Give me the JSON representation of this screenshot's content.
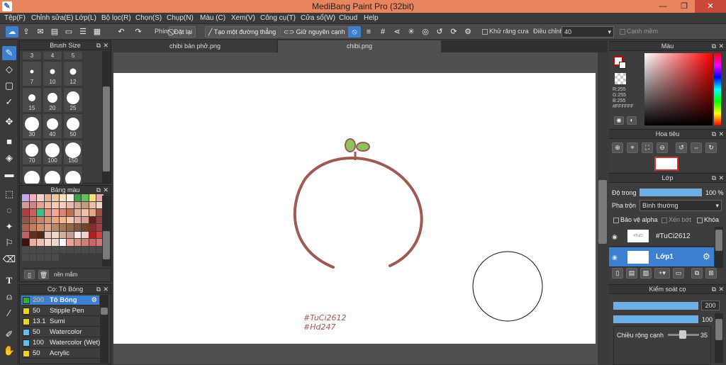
{
  "title": "MediBang Paint Pro (32bit)",
  "menu": [
    "Tệp(F)",
    "Chỉnh sửa(E)",
    "Lớp(L)",
    "Bộ lọc(R)",
    "Chọn(S)",
    "Chụp(N)",
    "Màu (C)",
    "Xem(V)",
    "Công cụ(T)",
    "Cửa sổ(W)",
    "Cloud",
    "Help"
  ],
  "toolbar": {
    "key_label": "Phím",
    "reset": "Đặt lại",
    "straight": "Tạo một đường thẳng",
    "keep_edge": "Giữ nguyên cạnh",
    "antialias": "Khử răng cưa",
    "adjust_label": "Điều chỉnh",
    "adjust_value": "40",
    "canh_mem": "Cạnh mềm"
  },
  "tabs": [
    "chibi bản phở.png",
    "chibi.png"
  ],
  "brush_size": {
    "title": "Brush Size",
    "sizes": [
      "3",
      "4",
      "5",
      "7",
      "10",
      "12",
      "15",
      "20",
      "25",
      "30",
      "40",
      "50",
      "70",
      "100",
      "150",
      "",
      "",
      ""
    ]
  },
  "palette": {
    "title": "Bảng màu",
    "name": "nền mắm",
    "colors": [
      "#c8a8e8",
      "#f0b0c0",
      "#f8d0d0",
      "#e8b090",
      "#f0c8a0",
      "#f8e0c0",
      "#f8f0e0",
      "#40a040",
      "#60c060",
      "#f0e080",
      "#e8a8a8",
      "#d89898",
      "#c88888",
      "#e8a090",
      "#f0b8a0",
      "#f8c8b0",
      "#f0d0c0",
      "#e8b8a8",
      "#d8a890",
      "#c89878",
      "#e8c0a8",
      "#f0d8c8",
      "#b04040",
      "#c86060",
      "#40c080",
      "#e89080",
      "#f0a898",
      "#d88870",
      "#c07050",
      "#e8b098",
      "#f0c0a8",
      "#e0a888",
      "#a05040",
      "#905848",
      "#b07058",
      "#c88868",
      "#d89878",
      "#e8a888",
      "#f0b898",
      "#f8c8a8",
      "#e8b0a0",
      "#d8a090",
      "#602020",
      "#904040",
      "#a86050",
      "#c08060",
      "#d09070",
      "#e0a080",
      "#b88868",
      "#a07858",
      "#906848",
      "#805838",
      "#704828",
      "#803030",
      "#a04040",
      "#c06060",
      "#603020",
      "#502818",
      "#e8c8b8",
      "#f0d8c8",
      "#d0b0a0",
      "#c0a090",
      "#f8e8e0",
      "#f0d0c8",
      "#b02020",
      "#d04040",
      "#401010",
      "#e8b0a0",
      "#f0c0b0",
      "#f8d8c8",
      "#e8d8d0",
      "#ffffff",
      "#f0a090",
      "#e09080",
      "#d08070",
      "#c86868",
      "#d07878",
      "",
      "",
      "",
      "",
      "",
      "",
      "",
      "",
      "",
      "",
      "",
      "",
      "",
      "",
      "",
      ""
    ]
  },
  "brush_list": {
    "title": "Cọ: Tô Bóng",
    "items": [
      {
        "v": "200",
        "name": "Tô Bóng",
        "color": "#30b030",
        "sel": true
      },
      {
        "v": "50",
        "name": "Stipple Pen",
        "color": "#f0d020"
      },
      {
        "v": "13.1",
        "name": "Sumi",
        "color": "#f0d020"
      },
      {
        "v": "50",
        "name": "Watercolor",
        "color": "#60c0f0"
      },
      {
        "v": "100",
        "name": "Watercolor (Wet)",
        "color": "#60c0f0"
      },
      {
        "v": "50",
        "name": "Acrylic",
        "color": "#f0d020"
      }
    ]
  },
  "canvas_text": [
    "#TuCi2612",
    "#Hd247"
  ],
  "color_panel": {
    "title": "Màu",
    "r": "R:255",
    "g": "G:255",
    "b": "B:255",
    "hex": "#FFFFFF"
  },
  "navigator": {
    "title": "Hoa tiêu"
  },
  "layer_panel": {
    "title": "Lớp",
    "opacity_label": "Độ trong",
    "opacity": "100 %",
    "blend_label": "Pha trộn",
    "blend": "Bình thường",
    "protect_alpha": "Bảo vệ alpha",
    "clip": "Xén bớt",
    "lock": "Khóa",
    "layers": [
      {
        "name": "#TuCi2612"
      },
      {
        "name": "Lớp1"
      }
    ]
  },
  "brush_control": {
    "title": "Kiểm soát cọ",
    "size": "200",
    "opacity": "100 %",
    "edge_label": "Chiều rộng cạnh",
    "edge": "35"
  },
  "accent": "#3d80d0",
  "stroke": "#a05a55",
  "sprout": "#8dc460"
}
